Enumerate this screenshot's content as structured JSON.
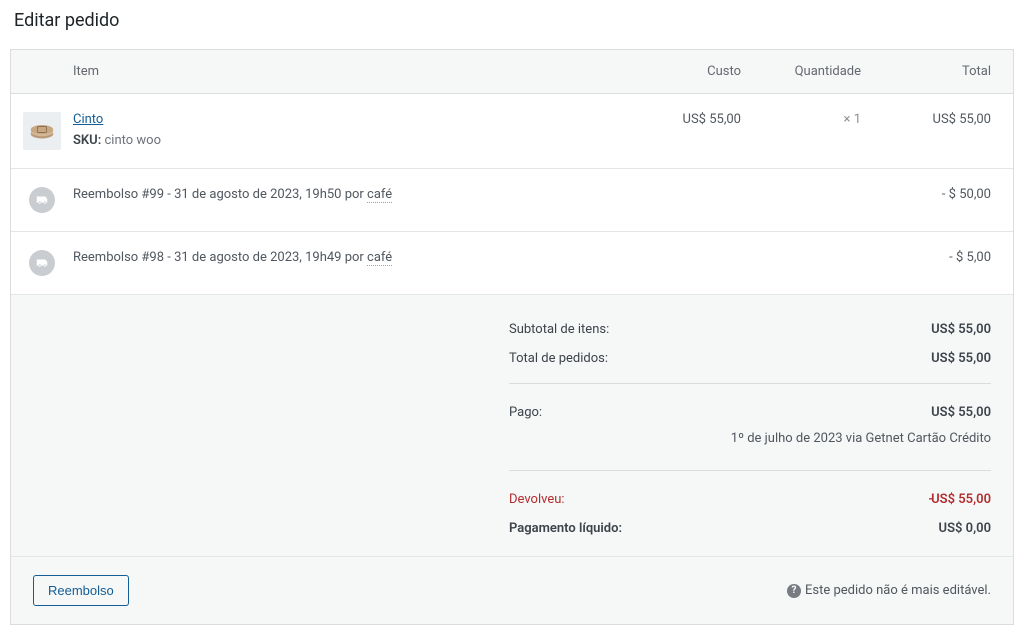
{
  "pageTitle": "Editar pedido",
  "headers": {
    "item": "Item",
    "cost": "Custo",
    "qty": "Quantidade",
    "total": "Total"
  },
  "line": {
    "name": "Cinto",
    "skuLabel": "SKU:",
    "sku": "cinto woo",
    "cost": "US$ 55,00",
    "qty": "× 1",
    "total": "US$ 55,00"
  },
  "refunds": [
    {
      "text": "Reembolso #99 - 31 de agosto de 2023, 19h50 por ",
      "by": "café",
      "amount": "- $ 50,00"
    },
    {
      "text": "Reembolso #98 - 31 de agosto de 2023, 19h49 por ",
      "by": "café",
      "amount": "- $ 5,00"
    }
  ],
  "totals": {
    "subtotalLabel": "Subtotal de itens:",
    "subtotal": "US$ 55,00",
    "ordersTotalLabel": "Total de pedidos:",
    "ordersTotal": "US$ 55,00",
    "paidLabel": "Pago:",
    "paid": "US$ 55,00",
    "paidNote": "1º de julho de 2023 via Getnet Cartão Crédito",
    "refundedLabel": "Devolveu:",
    "refunded": "US$ 55,00",
    "netLabel": "Pagamento líquido:",
    "net": "US$ 0,00"
  },
  "footer": {
    "refundBtn": "Reembolso",
    "notice": "Este pedido não é mais editável."
  }
}
